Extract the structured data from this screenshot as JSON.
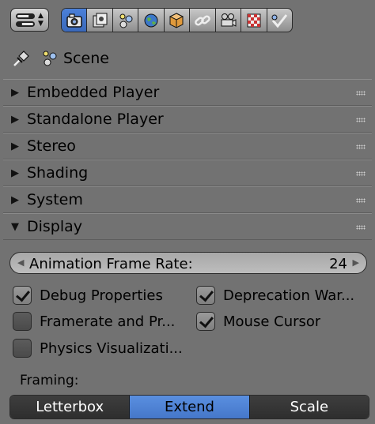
{
  "header": {
    "editor_type_icon": "editor-type-icon",
    "tabs": [
      {
        "name": "render",
        "icon": "camera-icon",
        "active": true
      },
      {
        "name": "render-layers",
        "icon": "render-layers-icon",
        "active": false
      },
      {
        "name": "scene",
        "icon": "scene-icon",
        "active": false
      },
      {
        "name": "world",
        "icon": "world-icon",
        "active": false
      },
      {
        "name": "object",
        "icon": "cube-icon",
        "active": false
      },
      {
        "name": "constraints",
        "icon": "link-icon",
        "active": false
      },
      {
        "name": "modifiers",
        "icon": "film-camera-icon",
        "active": false
      },
      {
        "name": "texture",
        "icon": "checker-icon",
        "active": false
      },
      {
        "name": "physics",
        "icon": "brush-icon",
        "active": false
      }
    ]
  },
  "context": {
    "scene_label": "Scene"
  },
  "panels": [
    {
      "title": "Embedded Player",
      "expanded": false,
      "tri": "▶"
    },
    {
      "title": "Standalone Player",
      "expanded": false,
      "tri": "▶"
    },
    {
      "title": "Stereo",
      "expanded": false,
      "tri": "▶"
    },
    {
      "title": "Shading",
      "expanded": false,
      "tri": "▶"
    },
    {
      "title": "System",
      "expanded": false,
      "tri": "▶"
    },
    {
      "title": "Display",
      "expanded": true,
      "tri": "▼"
    }
  ],
  "display": {
    "frame_rate_label": "Animation Frame Rate:",
    "frame_rate_value": "24",
    "checkboxes": [
      {
        "label": "Debug Properties",
        "checked": true
      },
      {
        "label": "Deprecation War...",
        "checked": true
      },
      {
        "label": "Framerate and Pr...",
        "checked": false
      },
      {
        "label": "Mouse Cursor",
        "checked": true
      },
      {
        "label": "Physics Visualizati...",
        "checked": false
      }
    ],
    "framing_label": "Framing:",
    "framing_options": [
      "Letterbox",
      "Extend",
      "Scale"
    ],
    "framing_selected": "Extend"
  },
  "colors": {
    "background": "#727272",
    "accent": "#4577c9"
  }
}
